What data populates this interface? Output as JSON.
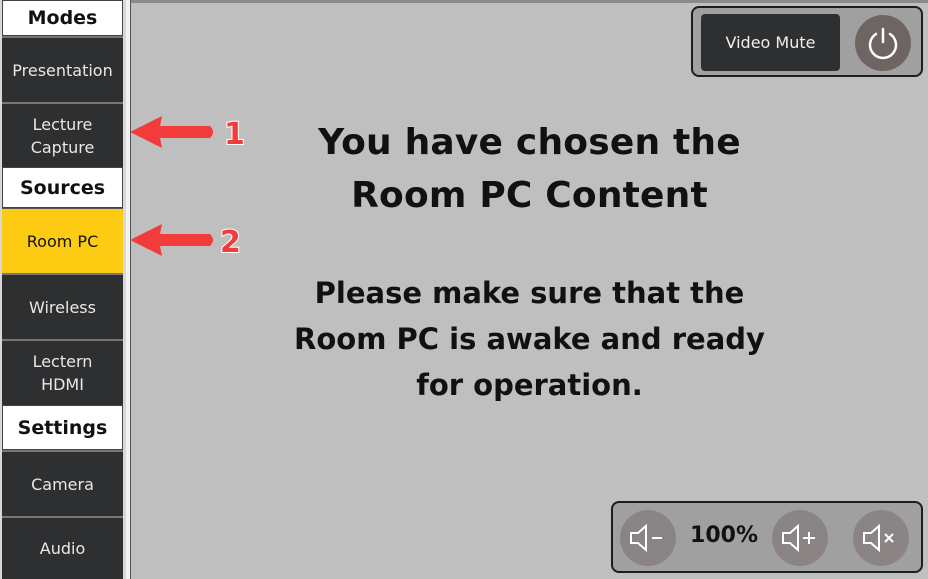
{
  "sidebar": {
    "sections": [
      {
        "header": "Modes",
        "items": [
          {
            "label": "Presentation"
          },
          {
            "label": "Lecture\nCapture"
          }
        ]
      },
      {
        "header": "Sources",
        "items": [
          {
            "label": "Room PC",
            "active": true
          },
          {
            "label": "Wireless"
          },
          {
            "label": "Lectern\nHDMI"
          }
        ]
      },
      {
        "header": "Settings",
        "items": [
          {
            "label": "Camera"
          },
          {
            "label": "Audio"
          }
        ]
      }
    ],
    "modes_header": "Modes",
    "presentation": "Presentation",
    "lecture_capture_line1": "Lecture",
    "lecture_capture_line2": "Capture",
    "sources_header": "Sources",
    "room_pc": "Room PC",
    "wireless": "Wireless",
    "lectern_line1": "Lectern",
    "lectern_line2": "HDMI",
    "settings_header": "Settings",
    "camera": "Camera",
    "audio": "Audio"
  },
  "annotations": [
    {
      "number": "1",
      "target": "Lecture Capture"
    },
    {
      "number": "2",
      "target": "Room PC"
    }
  ],
  "annotation_color": "#f23b3b",
  "active_color": "#fccb12",
  "message": {
    "title_line1": "You have chosen the",
    "title_line2": "Room PC Content",
    "body_line1": "Please make sure that the",
    "body_line2": "Room PC is awake and ready",
    "body_line3": "for operation."
  },
  "top_controls": {
    "video_mute_label": "Video Mute",
    "power_icon": "power-icon"
  },
  "volume": {
    "level": "100%",
    "down_icon": "volume-down-icon",
    "up_icon": "volume-up-icon",
    "mute_icon": "volume-mute-icon"
  }
}
